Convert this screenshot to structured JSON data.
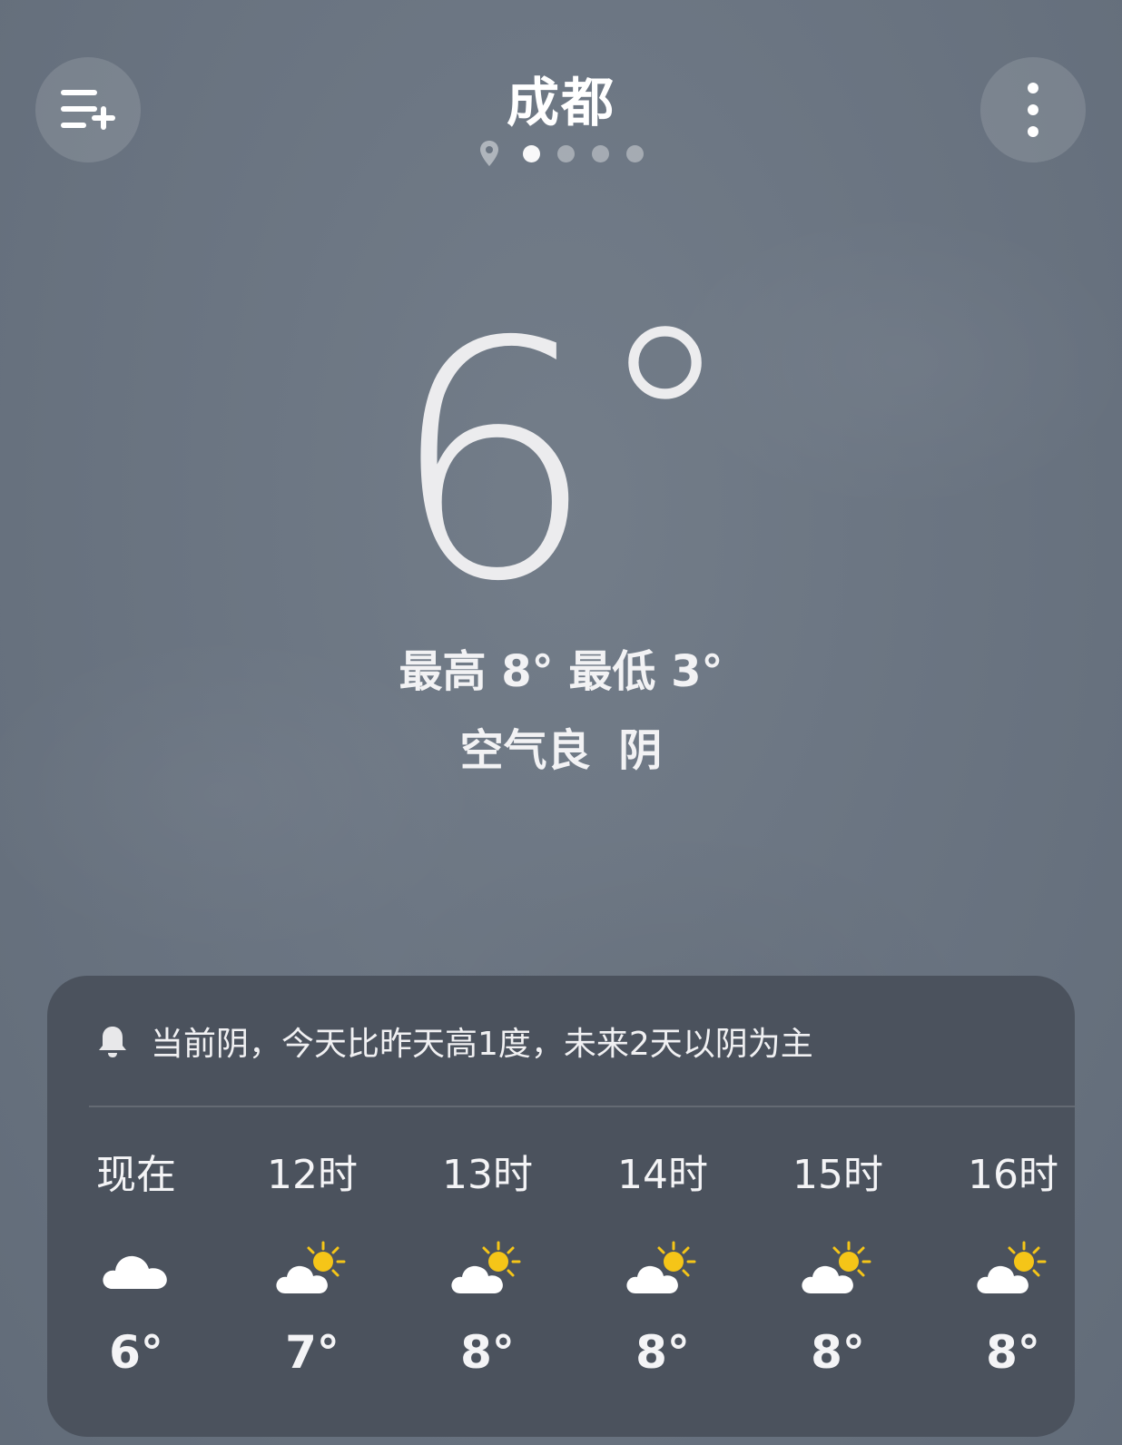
{
  "header": {
    "city": "成都",
    "menu_icon": "list-add-icon",
    "more_icon": "more-vertical-icon",
    "location_icon": "location-pin-icon",
    "page_count": 4,
    "active_page": 0
  },
  "current": {
    "temperature": "6",
    "degree_symbol": "°",
    "hilo": "最高 8° 最低 3°",
    "air_and_condition": "空气良 阴"
  },
  "forecast_card": {
    "notice_icon": "bell-icon",
    "notice": "当前阴，今天比昨天高1度，未来2天以阴为主",
    "hours": [
      {
        "label": "现在",
        "icon": "cloudy-icon",
        "temp": "6°"
      },
      {
        "label": "12时",
        "icon": "partly-sunny-icon",
        "temp": "7°"
      },
      {
        "label": "13时",
        "icon": "partly-sunny-icon",
        "temp": "8°"
      },
      {
        "label": "14时",
        "icon": "partly-sunny-icon",
        "temp": "8°"
      },
      {
        "label": "15时",
        "icon": "partly-sunny-icon",
        "temp": "8°"
      },
      {
        "label": "16时",
        "icon": "partly-sunny-icon",
        "temp": "8°"
      }
    ]
  },
  "colors": {
    "sun": "#f5c518",
    "card_bg": "#4b525d"
  }
}
